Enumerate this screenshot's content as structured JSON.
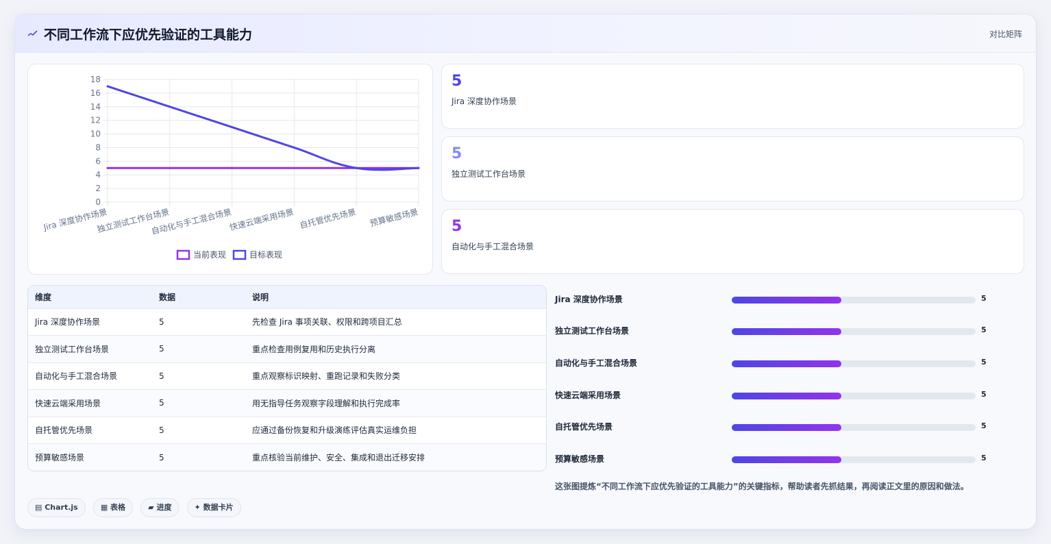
{
  "header": {
    "title": "不同工作流下应优先验证的工具能力",
    "badge": "对比矩阵",
    "icon": "sparkline-icon"
  },
  "colors": {
    "current": "#9333ea",
    "target": "#4f46e5",
    "kpi": [
      "#4f46e5",
      "#818cf8",
      "#9333ea"
    ]
  },
  "chart_data": {
    "type": "line",
    "categories": [
      "Jira 深度协作场景",
      "独立测试工作台场景",
      "自动化与手工混合场景",
      "快速云端采用场景",
      "自托管优先场景",
      "预算敏感场景"
    ],
    "series": [
      {
        "name": "当前表现",
        "values": [
          5,
          5,
          5,
          5,
          5,
          5
        ],
        "color": "#9333ea"
      },
      {
        "name": "目标表现",
        "values": [
          17,
          14,
          11,
          8,
          5,
          5
        ],
        "color": "#4f46e5"
      }
    ],
    "ylim": [
      0,
      18
    ],
    "yticks": [
      "0",
      "2",
      "4",
      "6",
      "8",
      "10",
      "12",
      "14",
      "16",
      "18"
    ],
    "grid": true,
    "legend": "bottom"
  },
  "kpis": [
    {
      "value": "5",
      "label": "Jira 深度协作场景"
    },
    {
      "value": "5",
      "label": "独立测试工作台场景"
    },
    {
      "value": "5",
      "label": "自动化与手工混合场景"
    }
  ],
  "table": {
    "headers": [
      "维度",
      "数据",
      "说明"
    ],
    "rows": [
      [
        "Jira 深度协作场景",
        "5",
        "先检查 Jira 事项关联、权限和跨项目汇总"
      ],
      [
        "独立测试工作台场景",
        "5",
        "重点检查用例复用和历史执行分离"
      ],
      [
        "自动化与手工混合场景",
        "5",
        "重点观察标识映射、重跑记录和失败分类"
      ],
      [
        "快速云端采用场景",
        "5",
        "用无指导任务观察字段理解和执行完成率"
      ],
      [
        "自托管优先场景",
        "5",
        "应通过备份恢复和升级演练评估真实运维负担"
      ],
      [
        "预算敏感场景",
        "5",
        "重点核验当前维护、安全、集成和退出迁移安排"
      ]
    ]
  },
  "progress": [
    {
      "label": "Jira 深度协作场景",
      "value": "5",
      "fraction": 0.45
    },
    {
      "label": "独立测试工作台场景",
      "value": "5",
      "fraction": 0.45
    },
    {
      "label": "自动化与手工混合场景",
      "value": "5",
      "fraction": 0.45
    },
    {
      "label": "快速云端采用场景",
      "value": "5",
      "fraction": 0.45
    },
    {
      "label": "自托管优先场景",
      "value": "5",
      "fraction": 0.45
    },
    {
      "label": "预算敏感场景",
      "value": "5",
      "fraction": 0.45
    }
  ],
  "note": "这张图提炼“不同工作流下应优先验证的工具能力”的关键指标，帮助读者先抓结果，再阅读正文里的原因和做法。",
  "tags": [
    {
      "icon": "chart-icon",
      "label": "▤ Chart.js"
    },
    {
      "icon": "table-icon",
      "label": "▦ 表格"
    },
    {
      "icon": "progress-icon",
      "label": "▰ 进度"
    },
    {
      "icon": "sparkle-icon",
      "label": "✦ 数据卡片"
    }
  ]
}
